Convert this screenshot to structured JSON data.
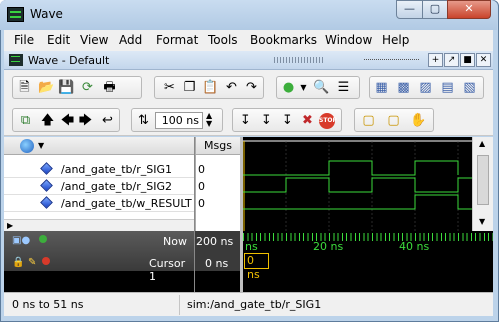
{
  "window": {
    "title": "Wave"
  },
  "menubar": {
    "items": [
      "File",
      "Edit",
      "View",
      "Add",
      "Format",
      "Tools",
      "Bookmarks",
      "Window",
      "Help"
    ]
  },
  "inner_window": {
    "title": "Wave - Default"
  },
  "toolbar": {
    "time_value": "100 ns",
    "icons": [
      "new-icon",
      "open-icon",
      "save-icon",
      "reload-icon",
      "print-icon",
      "cut-icon",
      "copy-icon",
      "paste-icon",
      "undo-icon",
      "redo-icon",
      "add-icon",
      "find-icon",
      "format-icon"
    ]
  },
  "wave": {
    "msgs_header": "Msgs",
    "signals": [
      {
        "name": "/and_gate_tb/r_SIG1",
        "value": "0"
      },
      {
        "name": "/and_gate_tb/r_SIG2",
        "value": "0"
      },
      {
        "name": "/and_gate_tb/w_RESULT",
        "value": "0"
      }
    ],
    "now_label": "Now",
    "now_value": "200 ns",
    "cursor_label": "Cursor 1",
    "cursor_value": "0 ns",
    "cursor_time_box": "0 ns",
    "timeline_labels": [
      "ns",
      "20 ns",
      "40 ns"
    ],
    "colors": {
      "wave": "#3cdc3c",
      "background": "#000000",
      "cursor": "#f0c000"
    }
  },
  "status": {
    "range": "0 ns to 51 ns",
    "sim_path": "sim:/and_gate_tb/r_SIG1"
  }
}
